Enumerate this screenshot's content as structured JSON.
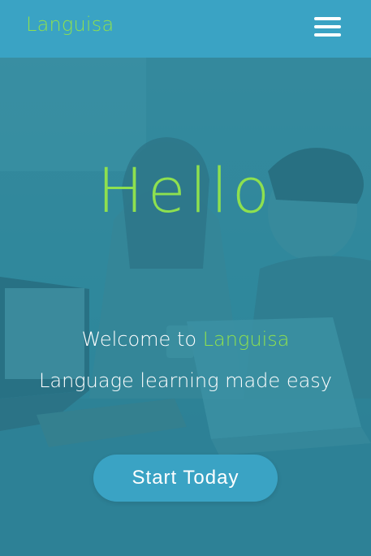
{
  "navbar": {
    "brand": "Languisa",
    "menu_icon": "hamburger-menu-icon"
  },
  "hero": {
    "title": "Hello",
    "welcome_prefix": "Welcome to",
    "welcome_brand": "Languisa",
    "tagline": "Language learning made easy",
    "cta_label": "Start Today"
  },
  "colors": {
    "brand_green": "#8ee04f",
    "primary_blue": "#3aa3c4",
    "overlay_teal": "#2f92aa",
    "text_white": "#ffffff"
  }
}
